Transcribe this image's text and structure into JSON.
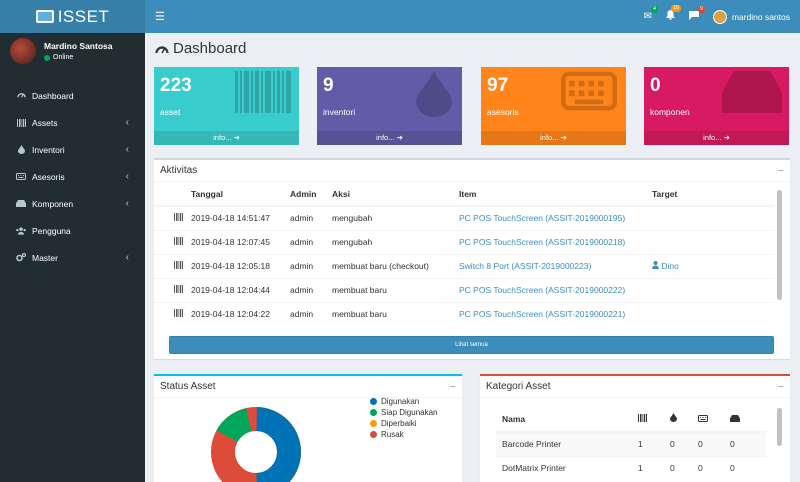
{
  "brand": {
    "logo_text": "ISSET"
  },
  "user": {
    "name": "Mardino Santosa",
    "status": "Online",
    "header_name": "mardino santos"
  },
  "header": {
    "badges": {
      "mail": "4",
      "bell": "10",
      "flag": "9"
    }
  },
  "sidebar": {
    "items": [
      {
        "label": "Dashboard",
        "icon": "dashboard-icon",
        "chevron": false
      },
      {
        "label": "Assets",
        "icon": "barcode-icon",
        "chevron": true
      },
      {
        "label": "Inventori",
        "icon": "tint-icon",
        "chevron": true
      },
      {
        "label": "Asesoris",
        "icon": "keyboard-icon",
        "chevron": true
      },
      {
        "label": "Komponen",
        "icon": "hdd-icon",
        "chevron": true
      },
      {
        "label": "Pengguna",
        "icon": "users-icon",
        "chevron": false
      },
      {
        "label": "Master",
        "icon": "cogs-icon",
        "chevron": true
      }
    ]
  },
  "page": {
    "title": "Dashboard"
  },
  "tiles": [
    {
      "num": "223",
      "label": "asset",
      "more": "info...",
      "color": "#39cccc"
    },
    {
      "num": "9",
      "label": "inventori",
      "more": "info...",
      "color": "#605ca8"
    },
    {
      "num": "97",
      "label": "asesoris",
      "more": "info...",
      "color": "#ff851b"
    },
    {
      "num": "0",
      "label": "komponen",
      "more": "info...",
      "color": "#d81b60"
    }
  ],
  "activity": {
    "title": "Aktivitas",
    "columns": [
      "Tanggal",
      "Admin",
      "Aksi",
      "Item",
      "Target"
    ],
    "rows": [
      {
        "date": "2019-04-18 14:51:47",
        "admin": "admin",
        "action": "mengubah",
        "item": "PC POS TouchScreen (ASSIT-2019000195)",
        "target": ""
      },
      {
        "date": "2019-04-18 12:07:45",
        "admin": "admin",
        "action": "mengubah",
        "item": "PC POS TouchScreen (ASSIT-2019000218)",
        "target": ""
      },
      {
        "date": "2019-04-18 12:05:18",
        "admin": "admin",
        "action": "membuat baru (checkout)",
        "item": "Switch 8 Port (ASSIT-2019000223)",
        "target": "Dino"
      },
      {
        "date": "2019-04-18 12:04:44",
        "admin": "admin",
        "action": "membuat baru",
        "item": "PC POS TouchScreen (ASSIT-2019000222)",
        "target": ""
      },
      {
        "date": "2019-04-18 12:04:22",
        "admin": "admin",
        "action": "membuat baru",
        "item": "PC POS TouchScreen (ASSIT-2019000221)",
        "target": ""
      }
    ],
    "see_all": "Lihat semua"
  },
  "status": {
    "title": "Status Asset",
    "legend": [
      {
        "label": "Digunakan",
        "color": "#0073b7"
      },
      {
        "label": "Siap Digunakan",
        "color": "#00a65a"
      },
      {
        "label": "Diperbaiki",
        "color": "#f39c12"
      },
      {
        "label": "Rusak",
        "color": "#dd4b39"
      }
    ]
  },
  "kategori": {
    "title": "Kategori Asset",
    "column_name": "Nama",
    "rows": [
      {
        "name": "Barcode Printer",
        "c1": "1",
        "c2": "0",
        "c3": "0",
        "c4": "0"
      },
      {
        "name": "DotMatrix Printer",
        "c1": "1",
        "c2": "0",
        "c3": "0",
        "c4": "0"
      }
    ]
  }
}
